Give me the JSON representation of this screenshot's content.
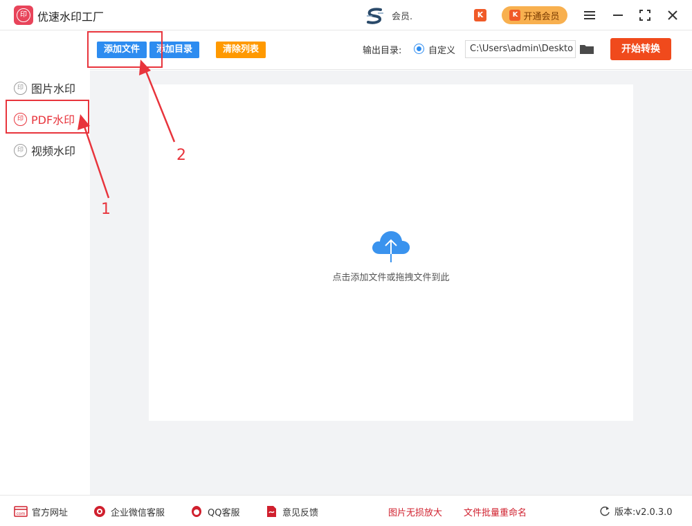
{
  "app": {
    "title": "优速水印工厂",
    "logo_char": "印"
  },
  "user": {
    "name": "会员."
  },
  "vip": {
    "badge": "K",
    "label": "开通会员"
  },
  "toolbar": {
    "add_file": "添加文件",
    "add_dir": "添加目录",
    "clear_list": "清除列表",
    "output_label": "输出目录:",
    "custom_option": "自定义",
    "output_path": "C:\\Users\\admin\\Deskto",
    "start": "开始转换"
  },
  "sidebar": {
    "items": [
      {
        "label": "图片水印",
        "icon_char": "印"
      },
      {
        "label": "PDF水印",
        "icon_char": "印"
      },
      {
        "label": "视频水印",
        "icon_char": "印"
      }
    ]
  },
  "dropzone": {
    "hint": "点击添加文件或拖拽文件到此"
  },
  "annotations": {
    "one": "1",
    "two": "2"
  },
  "footer": {
    "site": "官方网址",
    "site_icon_text": "com",
    "wechat": "企业微信客服",
    "qq": "QQ客服",
    "feedback": "意见反馈",
    "upscale": "图片无损放大",
    "rename": "文件批量重命名",
    "version": "版本:v2.0.3.0"
  },
  "colors": {
    "accent_blue": "#2d8cf0",
    "orange": "#ff9900",
    "start_red": "#f04a1c",
    "vip_gold": "#f8b04f",
    "annotation_red": "#e8343c"
  }
}
